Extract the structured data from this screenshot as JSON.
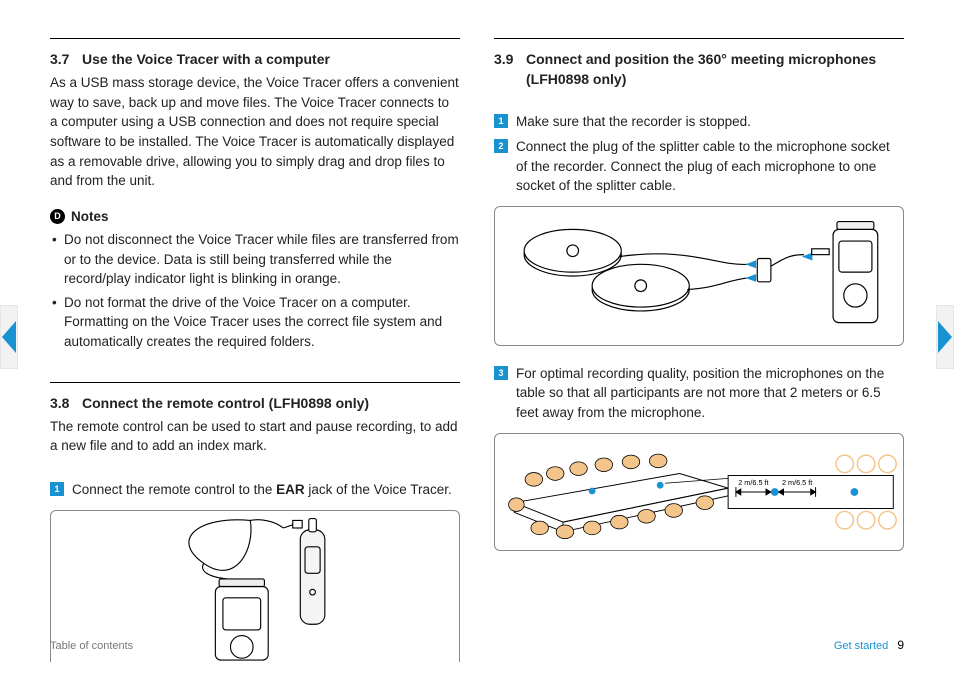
{
  "left": {
    "sec37": {
      "num": "3.7",
      "title": "Use the Voice Tracer with a computer",
      "body": "As a USB mass storage device, the Voice Tracer offers a convenient way to save, back up and move files. The Voice Tracer connects to a computer using a USB connection and does not require special software to be installed. The Voice Tracer is automatically displayed as a removable drive, allowing you to simply drag and drop files to and from the unit."
    },
    "notes": {
      "label": "Notes",
      "items": [
        "Do not disconnect the Voice Tracer while files are transferred from or to the device. Data is still being transferred while the record/play indicator light is blinking in orange.",
        "Do not format the drive of the Voice Tracer on a computer. Formatting on the Voice Tracer uses the correct file system and automatically creates the required folders."
      ]
    },
    "sec38": {
      "num": "3.8",
      "title": "Connect the remote control (LFH0898 only)",
      "body": "The remote control can be used to start and pause recording, to add a new file and to add an index mark.",
      "step1_pre": "Connect the remote control to the ",
      "step1_bold": "EAR",
      "step1_post": " jack of the Voice Tracer."
    }
  },
  "right": {
    "sec39": {
      "num": "3.9",
      "title_line1": "Connect and position the 360° meeting microphones",
      "title_line2": "(LFH0898 only)",
      "steps": [
        "Make sure that the recorder is stopped.",
        "Connect the plug of the splitter cable to the microphone socket of the recorder. Connect the plug of each microphone to one socket of the splitter cable."
      ],
      "step3": "For optimal recording quality, position the microphones on the table so that all participants are not more that 2 meters or 6.5 feet away from the microphone.",
      "distance_label": "2 m/6.5 ft"
    }
  },
  "footer": {
    "toc": "Table of contents",
    "section": "Get started",
    "page": "9"
  }
}
